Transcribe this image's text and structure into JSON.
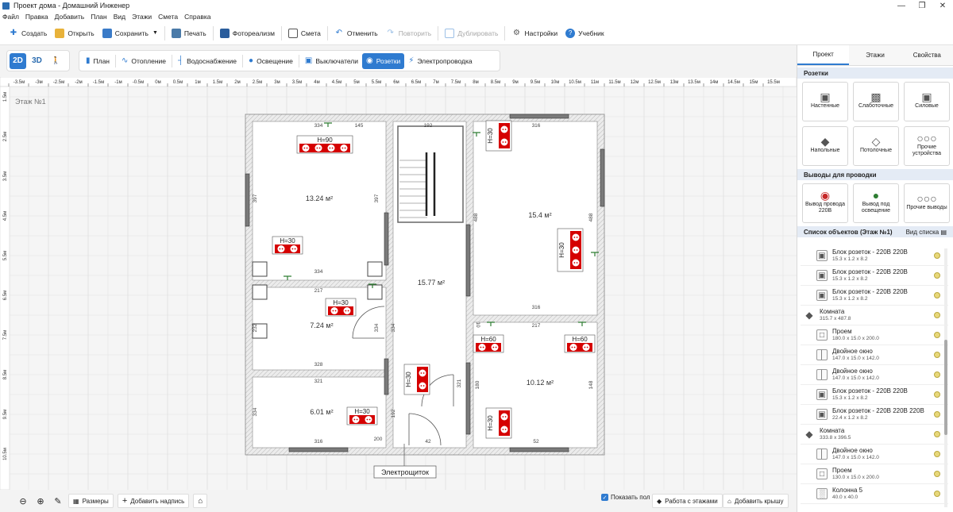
{
  "window": {
    "title": "Проект дома - Домашний Инженер"
  },
  "menu": [
    "Файл",
    "Правка",
    "Добавить",
    "План",
    "Вид",
    "Этажи",
    "Смета",
    "Справка"
  ],
  "toolbar": [
    {
      "id": "create",
      "label": "Создать",
      "icon": "new-file-icon",
      "enabled": true
    },
    {
      "id": "open",
      "label": "Открыть",
      "icon": "folder-icon",
      "enabled": true
    },
    {
      "id": "save",
      "label": "Сохранить",
      "icon": "save-icon",
      "enabled": true,
      "dropdown": true
    },
    {
      "id": "print",
      "label": "Печать",
      "icon": "printer-icon",
      "enabled": true
    },
    {
      "id": "photoreal",
      "label": "Фотореализм",
      "icon": "photo-icon",
      "enabled": true
    },
    {
      "id": "estimate",
      "label": "Смета",
      "icon": "calculator-icon",
      "enabled": true
    },
    {
      "id": "undo",
      "label": "Отменить",
      "icon": "undo-icon",
      "enabled": true
    },
    {
      "id": "redo",
      "label": "Повторить",
      "icon": "redo-icon",
      "enabled": false
    },
    {
      "id": "duplicate",
      "label": "Дублировать",
      "icon": "duplicate-icon",
      "enabled": false
    },
    {
      "id": "settings",
      "label": "Настройки",
      "icon": "gear-icon",
      "enabled": true
    },
    {
      "id": "tutorial",
      "label": "Учебник",
      "icon": "help-icon",
      "enabled": true
    }
  ],
  "view_modes": [
    {
      "label": "2D",
      "active": true
    },
    {
      "label": "3D",
      "active": false
    },
    {
      "label": "🚶",
      "active": false
    }
  ],
  "mode_tabs": [
    {
      "label": "План",
      "icon": "plan-icon",
      "active": false
    },
    {
      "label": "Отопление",
      "icon": "heating-icon",
      "active": false
    },
    {
      "label": "Водоснабжение",
      "icon": "water-icon",
      "active": false
    },
    {
      "label": "Освещение",
      "icon": "bulb-icon",
      "active": false
    },
    {
      "label": "Выключатели",
      "icon": "switch-icon",
      "active": false
    },
    {
      "label": "Розетки",
      "icon": "socket-icon",
      "active": true
    },
    {
      "label": "Электропроводка",
      "icon": "lightning-icon",
      "active": false
    }
  ],
  "canvas": {
    "floor_label": "Этаж №1",
    "ruler_top": [
      "-3.5м",
      "-3м",
      "-2.5м",
      "-2м",
      "-1.5м",
      "-1м",
      "-0.5м",
      "0м",
      "0.5м",
      "1м",
      "1.5м",
      "2м",
      "2.5м",
      "3м",
      "3.5м",
      "4м",
      "4.5м",
      "5м",
      "5.5м",
      "6м",
      "6.5м",
      "7м",
      "7.5м",
      "8м",
      "8.5м",
      "9м",
      "9.5м",
      "10м",
      "10.5м",
      "11м",
      "11.5м",
      "12м",
      "12.5м",
      "13м",
      "13.5м",
      "14м",
      "14.5м",
      "15м",
      "15.5м"
    ],
    "ruler_left": [
      "1.5м",
      "2.5м",
      "3.5м",
      "4.5м",
      "5.5м",
      "6.5м",
      "7.5м",
      "8.5м",
      "9.5м",
      "10.5м"
    ],
    "rooms": [
      {
        "area": "13.24 м²"
      },
      {
        "area": "15.4 м²"
      },
      {
        "area": "15.77 м²"
      },
      {
        "area": "7.24 м²"
      },
      {
        "area": "10.12 м²"
      },
      {
        "area": "6.01 м²"
      }
    ],
    "dimensions": [
      "334",
      "145",
      "192",
      "316",
      "397",
      "397",
      "488",
      "488",
      "334",
      "316",
      "217",
      "217",
      "232",
      "334",
      "334",
      "328",
      "321",
      "321",
      "180",
      "148",
      "334",
      "192",
      "316",
      "42",
      "52",
      "200",
      "10"
    ],
    "socket_heights": [
      "H=90",
      "H=30",
      "H=30",
      "H=30",
      "H=30",
      "H=60",
      "H=60",
      "H=30",
      "H=30"
    ],
    "panel_label": "Электрощиток"
  },
  "bottombar": {
    "sizes": "Размеры",
    "add_label": "Добавить надпись",
    "show_floor": "Показать пол",
    "floors_work": "Работа с этажами",
    "add_roof": "Добавить крышу"
  },
  "right_panel": {
    "tabs": [
      {
        "label": "Проект",
        "active": true
      },
      {
        "label": "Этажи",
        "active": false
      },
      {
        "label": "Свойства",
        "active": false
      }
    ],
    "sockets_title": "Розетки",
    "socket_categories": [
      {
        "label": "Настенные",
        "icon": "wall-socket-icon"
      },
      {
        "label": "Слаботочные",
        "icon": "lowcurrent-socket-icon"
      },
      {
        "label": "Силовые",
        "icon": "power-socket-icon"
      },
      {
        "label": "Напольные",
        "icon": "floor-socket-icon"
      },
      {
        "label": "Потолочные",
        "icon": "ceiling-socket-icon"
      },
      {
        "label": "Прочие устройства",
        "icon": "more-icon"
      }
    ],
    "outputs_title": "Выводы для проводки",
    "output_categories": [
      {
        "label": "Вывод провода 220В",
        "icon": "wire-output-icon"
      },
      {
        "label": "Вывод под освещение",
        "icon": "light-output-icon"
      },
      {
        "label": "Прочие выводы",
        "icon": "more-icon"
      }
    ],
    "objects_title": "Список объектов (Этаж №1)",
    "view_list": "Вид списка",
    "objects": [
      {
        "name": "Блок розеток - 220В 220В",
        "size": "15.3 x 1.2 x 8.2",
        "level": 1,
        "icon": "socket-icon"
      },
      {
        "name": "Блок розеток - 220В 220В",
        "size": "15.3 x 1.2 x 8.2",
        "level": 1,
        "icon": "socket-icon"
      },
      {
        "name": "Блок розеток - 220В 220В",
        "size": "15.3 x 1.2 x 8.2",
        "level": 1,
        "icon": "socket-icon"
      },
      {
        "name": "Комната",
        "size": "315.7 x 487.8",
        "level": 0,
        "icon": "room-icon"
      },
      {
        "name": "Проем",
        "size": "180.0 x 15.0 x 200.0",
        "level": 1,
        "icon": "opening-icon"
      },
      {
        "name": "Двойное окно",
        "size": "147.0 x 15.0 x 142.0",
        "level": 1,
        "icon": "window-icon"
      },
      {
        "name": "Двойное окно",
        "size": "147.0 x 15.0 x 142.0",
        "level": 1,
        "icon": "window-icon"
      },
      {
        "name": "Блок розеток - 220В 220В",
        "size": "15.3 x 1.2 x 8.2",
        "level": 1,
        "icon": "socket-icon"
      },
      {
        "name": "Блок розеток - 220В 220В 220В",
        "size": "22.4 x 1.2 x 8.2",
        "level": 1,
        "icon": "socket-icon"
      },
      {
        "name": "Комната",
        "size": "333.8 x 396.5",
        "level": 0,
        "icon": "room-icon"
      },
      {
        "name": "Двойное окно",
        "size": "147.0 x 15.0 x 142.0",
        "level": 1,
        "icon": "window-icon"
      },
      {
        "name": "Проем",
        "size": "130.0 x 15.0 x 200.0",
        "level": 1,
        "icon": "opening-icon"
      },
      {
        "name": "Колонна 5",
        "size": "40.0 x 40.0",
        "level": 1,
        "icon": "column-icon"
      }
    ]
  }
}
